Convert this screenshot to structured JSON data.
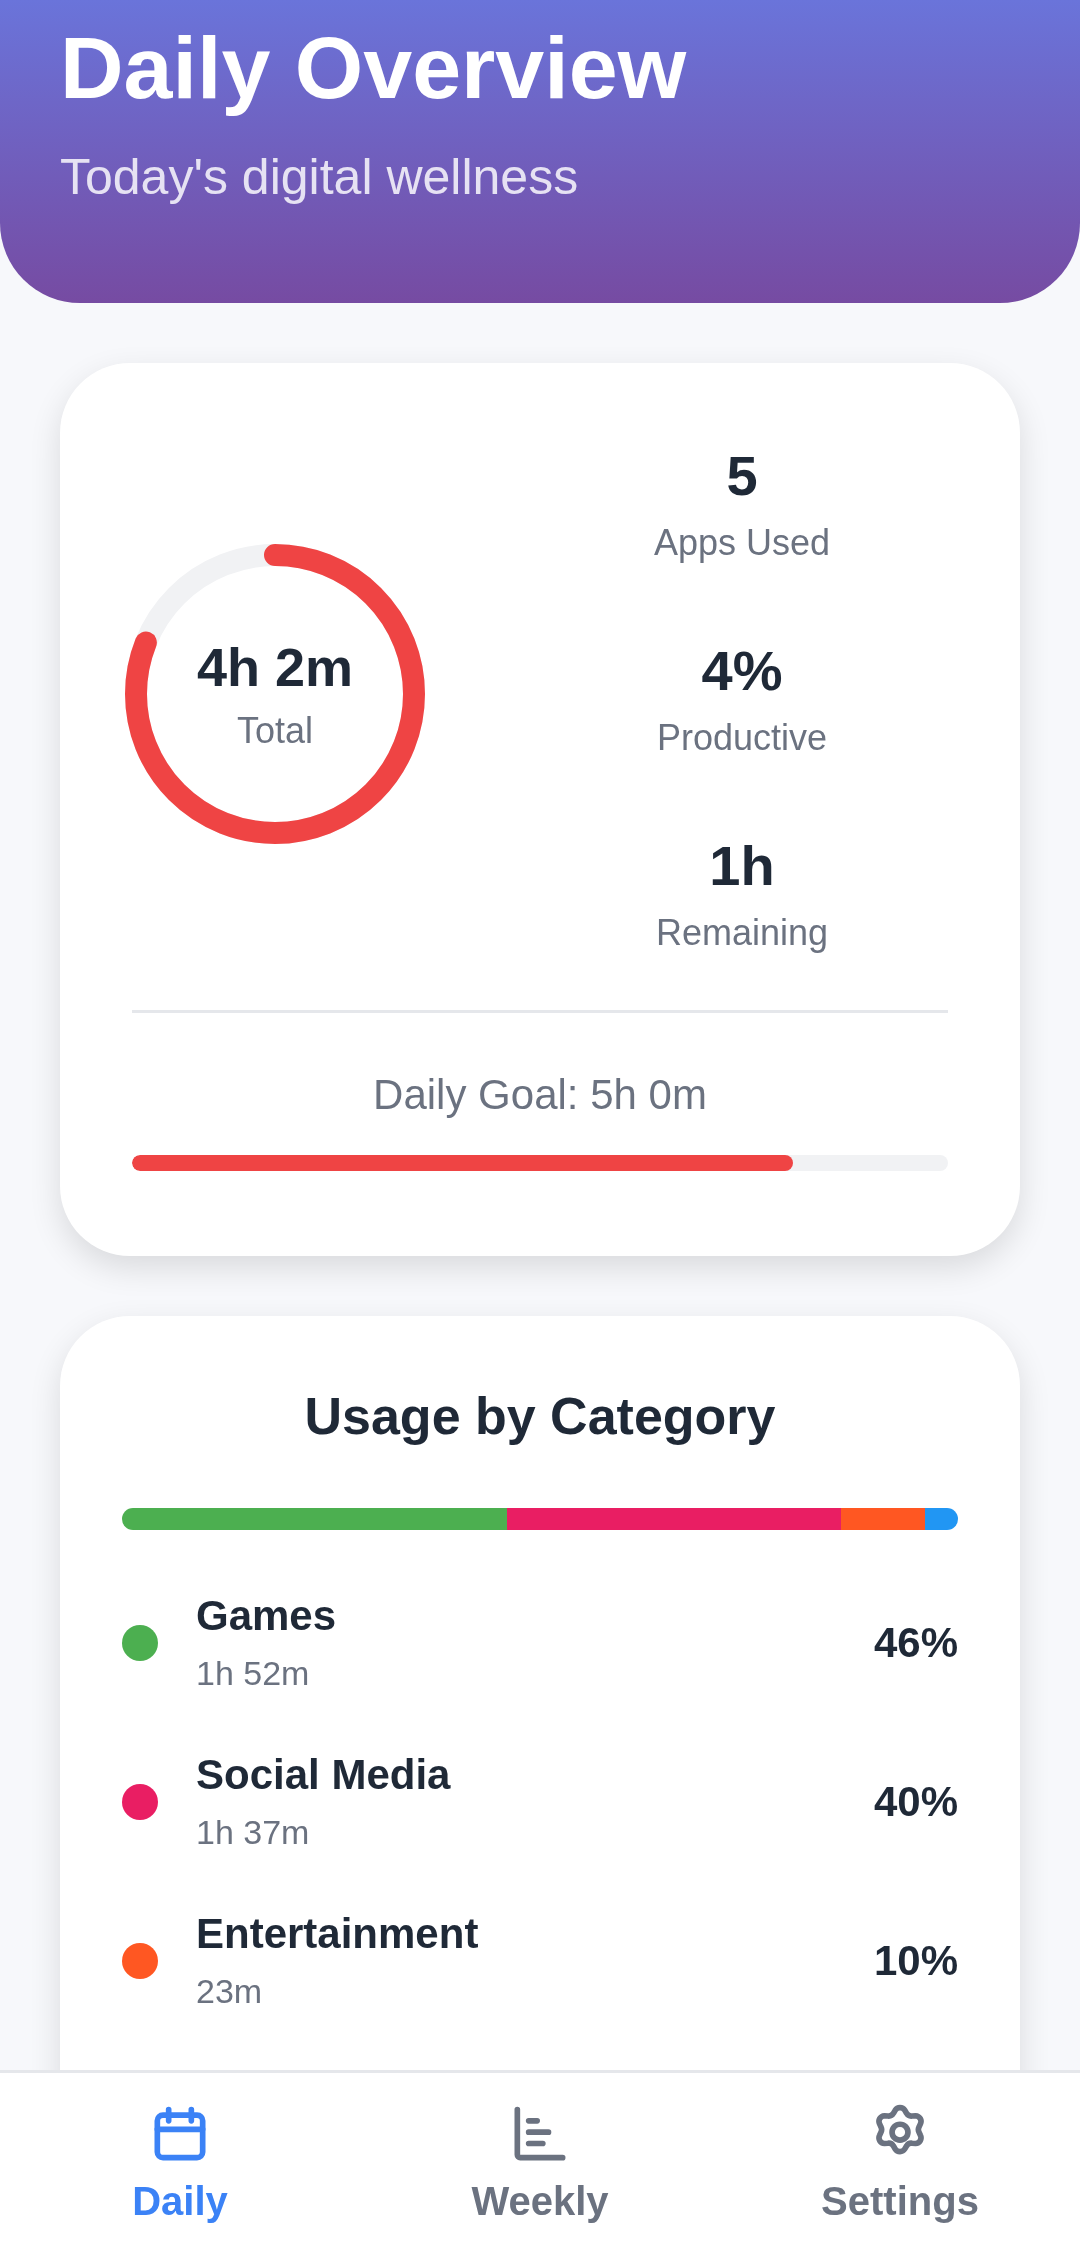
{
  "header": {
    "title": "Daily Overview",
    "subtitle": "Today's digital wellness"
  },
  "summary": {
    "total": {
      "value": "4h 2m",
      "label": "Total",
      "level": 0.81
    },
    "stats": [
      {
        "value": "5",
        "label": "Apps Used"
      },
      {
        "value": "4%",
        "label": "Productive"
      },
      {
        "value": "1h",
        "label": "Remaining"
      }
    ],
    "goal": {
      "label": "Daily Goal: 5h 0m",
      "level": 0.81
    }
  },
  "categories": {
    "title": "Usage by Category",
    "bar_segments": [
      {
        "color": "#4caf50"
      },
      {
        "color": "#e91e63"
      },
      {
        "color": "#ff5722"
      },
      {
        "color": "#2196f3"
      }
    ],
    "items": [
      {
        "name": "Games",
        "time": "1h 52m",
        "percent": "46%",
        "color": "#4caf50"
      },
      {
        "name": "Social Media",
        "time": "1h 37m",
        "percent": "40%",
        "color": "#e91e63"
      },
      {
        "name": "Entertainment",
        "time": "23m",
        "percent": "10%",
        "color": "#ff5722"
      }
    ]
  },
  "nav": [
    {
      "label": "Daily",
      "selected": true
    },
    {
      "label": "Weekly",
      "selected": false
    },
    {
      "label": "Settings",
      "selected": false
    }
  ]
}
